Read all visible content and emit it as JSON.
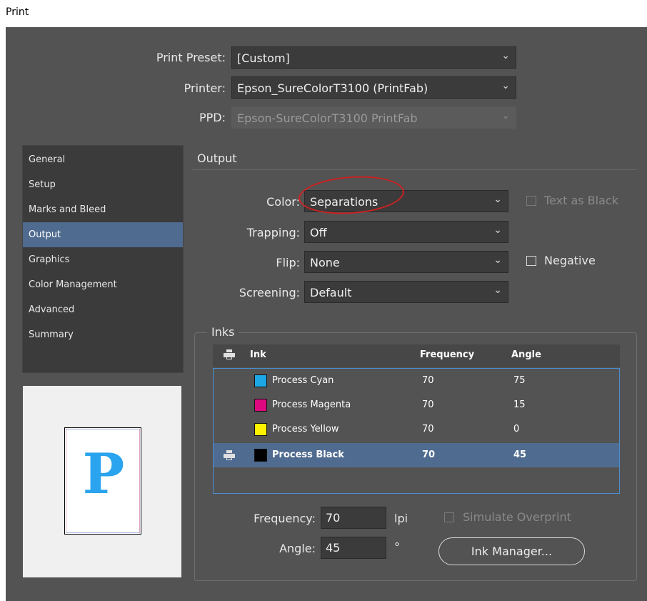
{
  "window": {
    "title": "Print"
  },
  "print_preset": {
    "label": "Print Preset:",
    "value": "[Custom]"
  },
  "printer": {
    "label": "Printer:",
    "value": "Epson_SureColorT3100 (PrintFab)"
  },
  "ppd": {
    "label": "PPD:",
    "value": "Epson-SureColorT3100 PrintFab"
  },
  "sidebar": {
    "items": [
      {
        "label": "General"
      },
      {
        "label": "Setup"
      },
      {
        "label": "Marks and Bleed"
      },
      {
        "label": "Output"
      },
      {
        "label": "Graphics"
      },
      {
        "label": "Color Management"
      },
      {
        "label": "Advanced"
      },
      {
        "label": "Summary"
      }
    ],
    "selected": "Output"
  },
  "preview": {
    "letter": "P"
  },
  "output": {
    "section_title": "Output",
    "color": {
      "label": "Color:",
      "value": "Separations"
    },
    "text_as_black": {
      "label": "Text as Black",
      "checked": false,
      "enabled": false
    },
    "trapping": {
      "label": "Trapping:",
      "value": "Off"
    },
    "flip": {
      "label": "Flip:",
      "value": "None"
    },
    "negative": {
      "label": "Negative",
      "checked": false
    },
    "screening": {
      "label": "Screening:",
      "value": "Default"
    }
  },
  "inks": {
    "group_title": "Inks",
    "columns": {
      "print": "printer-icon",
      "ink": "Ink",
      "frequency": "Frequency",
      "angle": "Angle"
    },
    "rows": [
      {
        "name": "Process Cyan",
        "color": "#1ea7e6",
        "frequency": "70",
        "angle": "75",
        "printing": false
      },
      {
        "name": "Process Magenta",
        "color": "#e0087f",
        "frequency": "70",
        "angle": "15",
        "printing": false
      },
      {
        "name": "Process Yellow",
        "color": "#fff200",
        "frequency": "70",
        "angle": "0",
        "printing": false
      },
      {
        "name": "Process Black",
        "color": "#000000",
        "frequency": "70",
        "angle": "45",
        "printing": true,
        "selected": true
      }
    ],
    "frequency": {
      "label": "Frequency:",
      "value": "70",
      "unit": "lpi"
    },
    "angle": {
      "label": "Angle:",
      "value": "45",
      "unit": "°"
    },
    "simulate_overprint": {
      "label": "Simulate Overprint",
      "checked": false,
      "enabled": false
    },
    "ink_manager_button": "Ink Manager..."
  },
  "colors": {
    "dialog_bg": "#535353",
    "selected": "#4f6b8f",
    "list_border": "#4a8fd0",
    "annotation": "#cc2222"
  }
}
